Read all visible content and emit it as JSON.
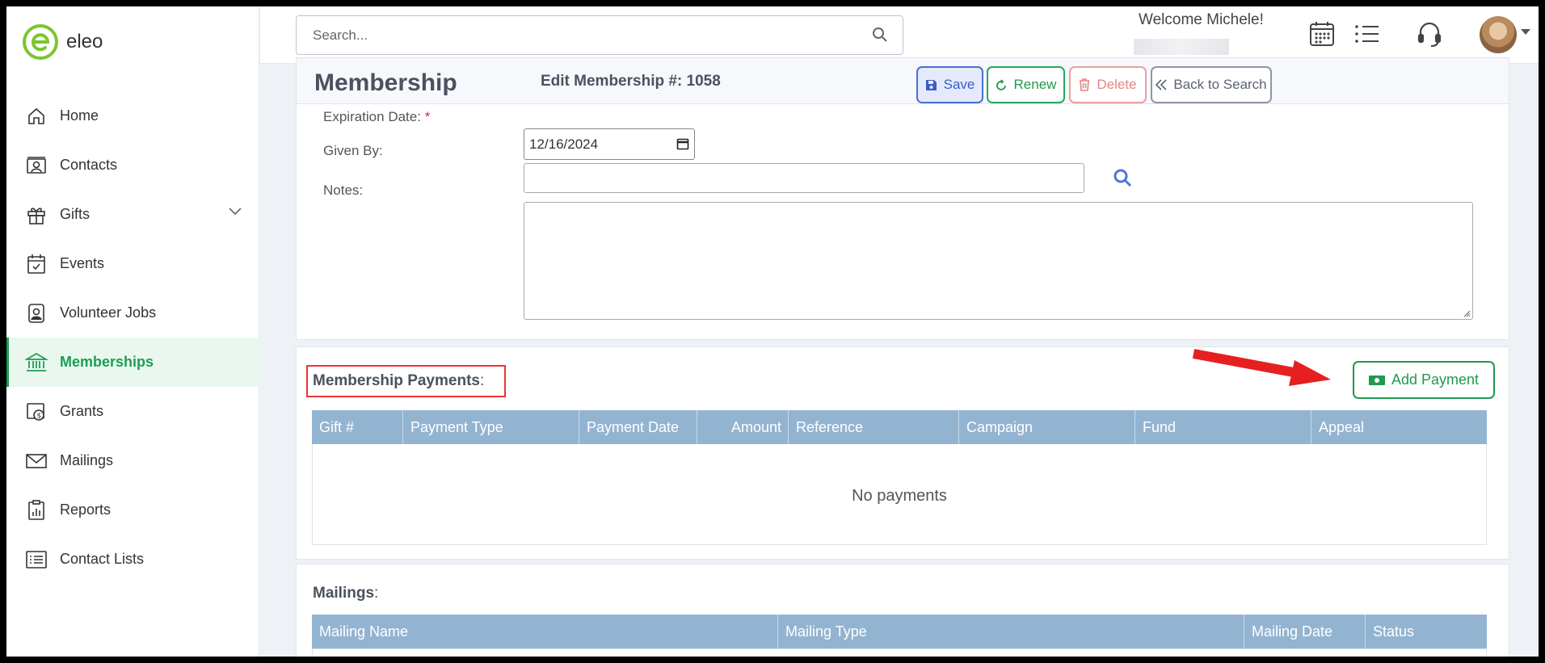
{
  "app": {
    "logo_text": "eleo"
  },
  "sidebar": {
    "items": [
      {
        "label": "Home",
        "icon": "home-icon"
      },
      {
        "label": "Contacts",
        "icon": "contacts-icon"
      },
      {
        "label": "Gifts",
        "icon": "gift-icon",
        "expandable": true
      },
      {
        "label": "Events",
        "icon": "calendar-check-icon"
      },
      {
        "label": "Volunteer Jobs",
        "icon": "badge-icon"
      },
      {
        "label": "Memberships",
        "icon": "bank-icon",
        "active": true
      },
      {
        "label": "Grants",
        "icon": "grant-icon"
      },
      {
        "label": "Mailings",
        "icon": "envelope-icon"
      },
      {
        "label": "Reports",
        "icon": "report-icon"
      },
      {
        "label": "Contact Lists",
        "icon": "list-icon"
      }
    ]
  },
  "header": {
    "search_placeholder": "Search...",
    "welcome": "Welcome Michele!"
  },
  "titlebar": {
    "title": "Membership",
    "edit_title": "Edit Membership #: 1058",
    "save": "Save",
    "renew": "Renew",
    "delete": "Delete",
    "back": "Back to Search"
  },
  "form": {
    "expiration_label": "Expiration Date:",
    "required_mark": "*",
    "expiration_value": "12/16/2024",
    "given_by_label": "Given By:",
    "notes_label": "Notes:"
  },
  "payments": {
    "title": "Membership Payments",
    "colon": ":",
    "add_button": "Add Payment",
    "columns": [
      "Gift #",
      "Payment Type",
      "Payment Date",
      "Amount",
      "Reference",
      "Campaign",
      "Fund",
      "Appeal"
    ],
    "empty_text": "No payments"
  },
  "mailings": {
    "title": "Mailings",
    "colon": ":",
    "columns": [
      "Mailing Name",
      "Mailing Type",
      "Mailing Date",
      "Status"
    ]
  },
  "colors": {
    "brand_green": "#1e9e53",
    "table_header": "#93b4d1",
    "annotation_red": "#e33333"
  }
}
